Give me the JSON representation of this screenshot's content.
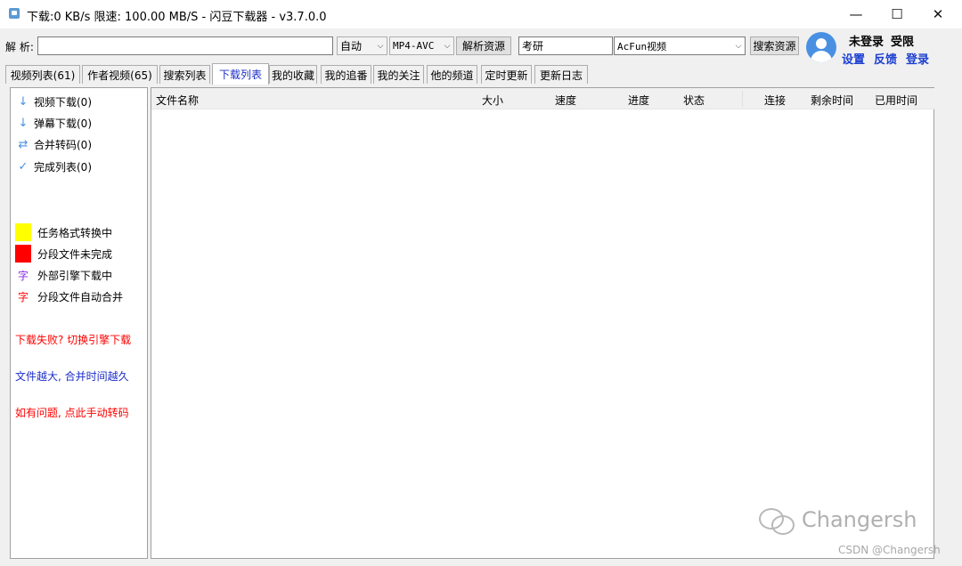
{
  "window": {
    "title": "下载:0 KB/s  限速: 100.00 MB/S  - 闪豆下载器 - v3.7.0.0",
    "minimize": "—",
    "maximize": "☐",
    "close": "✕"
  },
  "toolbar": {
    "parse_label": "解 析:",
    "parse_input_value": "",
    "quality_select": "自动",
    "format_select": "MP4-AVC",
    "parse_button": "解析资源",
    "search_input_value": "考研",
    "site_select": "AcFun视频",
    "search_button": "搜索资源"
  },
  "user": {
    "status": "未登录",
    "limit": "受限",
    "settings": "设置",
    "feedback": "反馈",
    "login": "登录"
  },
  "tabs": [
    {
      "label": "视频列表(61)"
    },
    {
      "label": "作者视频(65)"
    },
    {
      "label": "搜索列表"
    },
    {
      "label": "下载列表",
      "active": true
    },
    {
      "label": "我的收藏"
    },
    {
      "label": "我的追番"
    },
    {
      "label": "我的关注"
    },
    {
      "label": "他的频道"
    },
    {
      "label": "定时更新"
    },
    {
      "label": "更新日志"
    }
  ],
  "sidebar": {
    "items": [
      {
        "icon": "download-arrow-icon",
        "label": "视频下载(0)"
      },
      {
        "icon": "download-arrow-icon",
        "label": "弹幕下载(0)"
      },
      {
        "icon": "swap-arrows-icon",
        "label": "合并转码(0)"
      },
      {
        "icon": "checkmark-icon",
        "label": "完成列表(0)"
      }
    ],
    "legend": [
      {
        "label": "任务格式转换中",
        "color": "#ffff00"
      },
      {
        "label": "分段文件未完成",
        "color": "#ff0000"
      },
      {
        "label": "外部引擎下载中",
        "char": "字",
        "color": "#8a2be2"
      },
      {
        "label": "分段文件自动合并",
        "char": "字",
        "color": "#ff0000"
      }
    ],
    "notes": [
      {
        "text": "下载失败? 切换引擎下载",
        "color": "#ff0000"
      },
      {
        "text": "文件越大, 合并时间越久",
        "color": "#1e2fc8"
      },
      {
        "text": "如有问题, 点此手动转码",
        "color": "#ff0000"
      }
    ]
  },
  "table": {
    "columns": [
      "文件名称",
      "大小",
      "速度",
      "进度",
      "状态",
      "连接",
      "剩余时间",
      "已用时间"
    ],
    "rows": []
  },
  "watermark": {
    "name": "Changersh",
    "csdn": "CSDN @Changersh"
  }
}
